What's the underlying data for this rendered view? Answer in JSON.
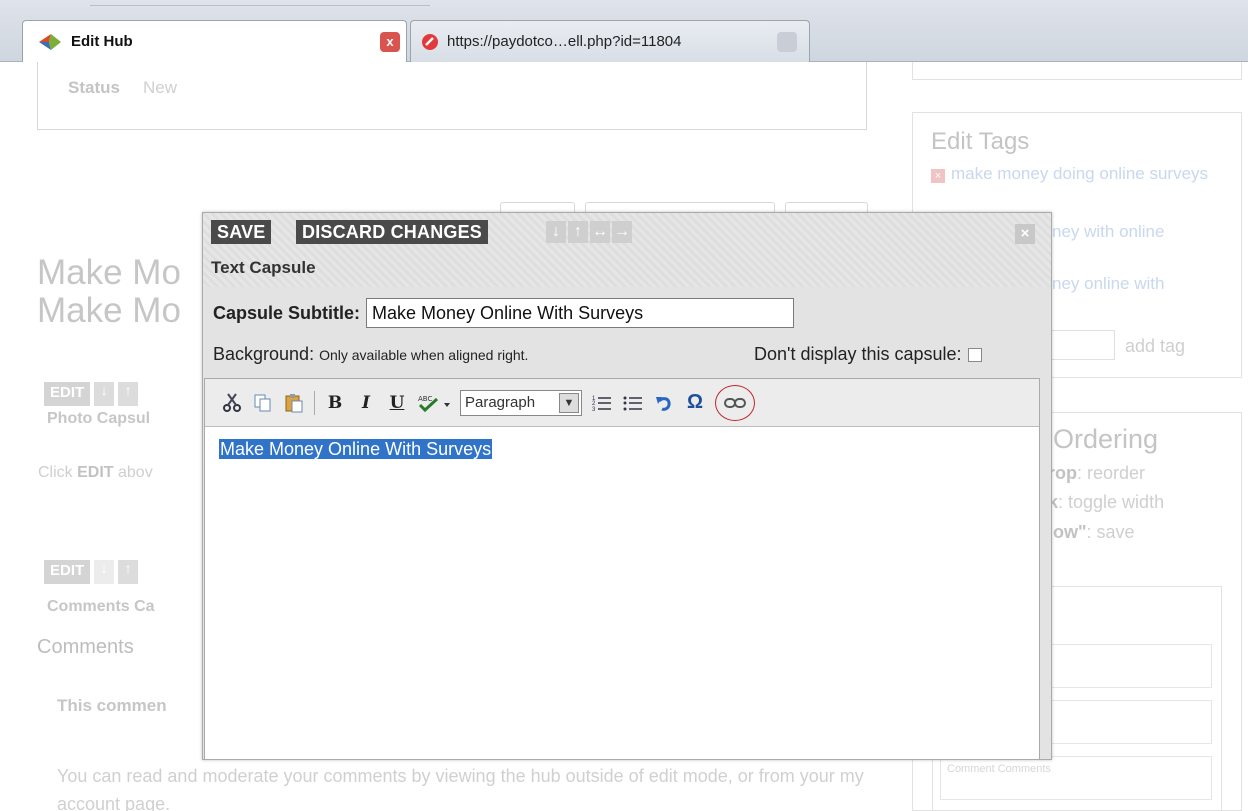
{
  "browser": {
    "tabs": [
      {
        "title": "Edit Hub",
        "close": "x",
        "active": true
      },
      {
        "title": "https://paydotco…ell.php?id=11804",
        "close": "",
        "active": false
      }
    ]
  },
  "background_page": {
    "status_label": "Status",
    "status_value": "New",
    "hub_title": "Make Mo\nMake Mo",
    "photo_capsule": {
      "edit": "EDIT",
      "label": "Photo Capsul",
      "hint_pre": "Click ",
      "hint_bold": "EDIT",
      "hint_post": " abov"
    },
    "comments_capsule": {
      "edit": "EDIT",
      "label": "Comments Ca"
    },
    "comments_heading": "Comments",
    "comments_note": "This commen",
    "read_moderate": "You can read and moderate your comments by viewing the hub outside of edit mode, or from your my account page."
  },
  "sidebar": {
    "edit_tags_heading": "Edit Tags",
    "tags": [
      "make money doing online surveys",
      "ney with online",
      "ney online with"
    ],
    "add_tag": "add tag",
    "ordering_heading": "Ordering",
    "ordering_lines": [
      {
        "bold": "rop",
        "text": ": reorder"
      },
      {
        "bold": "k",
        "text": ": toggle width"
      },
      {
        "bold": "low\"",
        "text": ": save"
      }
    ],
    "comment_placeholder": "Comment Comments"
  },
  "modal": {
    "save": "SAVE",
    "discard": "DISCARD CHANGES",
    "arrows": [
      "↓",
      "↑",
      "↔",
      "→"
    ],
    "close": "×",
    "title": "Text Capsule",
    "subtitle_label": "Capsule Subtitle:",
    "subtitle_value": "Make Money Online With Surveys",
    "background_label": "Background:",
    "background_note": "Only available when aligned right.",
    "dont_display_label": "Don't display this capsule:",
    "format_select": "Paragraph",
    "editor_text": "Make Money Online With Surveys",
    "highlight_color": "#3074c9",
    "link_circle_color": "#c0272d"
  }
}
